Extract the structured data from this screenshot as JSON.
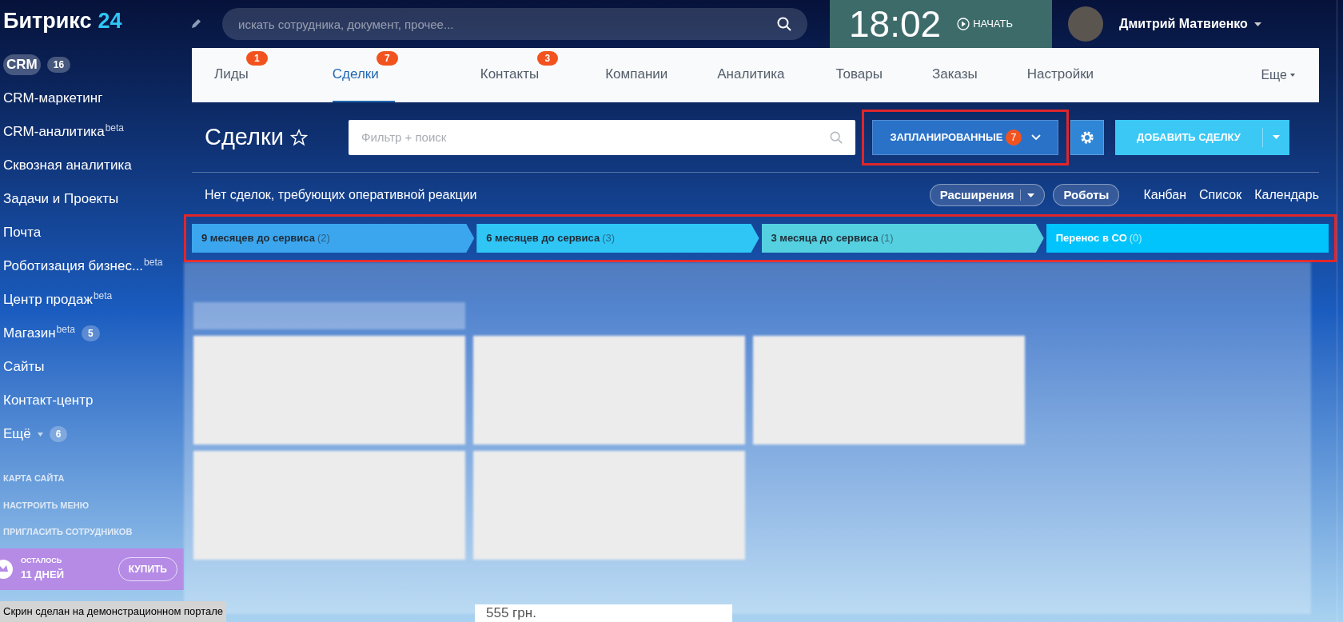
{
  "logo": {
    "name": "Битрикс",
    "number": "24"
  },
  "search": {
    "placeholder": "искать сотрудника, документ, прочее..."
  },
  "clock": {
    "time": "18:02",
    "start_label": "НАЧАТЬ"
  },
  "user": {
    "name": "Дмитрий Матвиенко"
  },
  "sidebar": {
    "items": [
      {
        "label": "CRM",
        "selected": true,
        "counter": "16"
      },
      {
        "label": "CRM-маркетинг",
        "selected": false
      },
      {
        "label": "CRM-аналитика",
        "selected": false,
        "sup": "beta"
      },
      {
        "label": "Сквозная аналитика",
        "selected": false
      },
      {
        "label": "Задачи и Проекты",
        "selected": false
      },
      {
        "label": "Почта",
        "selected": false
      },
      {
        "label": "Роботизация бизнес...",
        "selected": false,
        "sup": "beta"
      },
      {
        "label": "Центр продаж",
        "selected": false,
        "sup": "beta"
      },
      {
        "label": "Магазин",
        "selected": false,
        "sup": "beta",
        "counter": "5"
      },
      {
        "label": "Сайты",
        "selected": false
      },
      {
        "label": "Контакт-центр",
        "selected": false
      },
      {
        "label": "Ещё",
        "selected": false,
        "caret": true,
        "counter": "6"
      }
    ],
    "links": [
      "КАРТА САЙТА",
      "НАСТРОИТЬ МЕНЮ",
      "ПРИГЛАСИТЬ СОТРУДНИКОВ"
    ],
    "promo": {
      "caption": "ОСТАЛОСЬ",
      "days": "11 ДНЕЙ",
      "button": "КУПИТЬ"
    }
  },
  "tabs": [
    {
      "label": "Лиды",
      "counter": "1",
      "selected": false
    },
    {
      "label": "Сделки",
      "counter": "7",
      "selected": true
    },
    {
      "label": "Контакты",
      "counter": "3",
      "selected": false
    },
    {
      "label": "Компании",
      "selected": false
    },
    {
      "label": "Аналитика",
      "selected": false
    },
    {
      "label": "Товары",
      "selected": false
    },
    {
      "label": "Заказы",
      "selected": false
    },
    {
      "label": "Настройки",
      "selected": false
    }
  ],
  "more_tab": "Еще",
  "page_title": "Сделки",
  "filter": {
    "placeholder": "Фильтр + поиск"
  },
  "planned_button": {
    "label": "ЗАПЛАНИРОВАННЫЕ",
    "counter": "7",
    "highlighted": true
  },
  "add_button": {
    "label": "ДОБАВИТЬ СДЕЛКУ"
  },
  "notice": "Нет сделок, требующих оперативной реакции",
  "toolbar": {
    "extensions": "Расширения",
    "robots": "Роботы",
    "views": [
      "Канбан",
      "Список",
      "Календарь"
    ]
  },
  "stages": {
    "highlighted": true,
    "items": [
      {
        "label": "9 месяцев до сервиса",
        "count": "(2)",
        "color": "#3ba6ee"
      },
      {
        "label": "6 месяцев до сервиса",
        "count": "(3)",
        "color": "#2fc6f6"
      },
      {
        "label": "3 месяца до сервиса",
        "count": "(1)",
        "color": "#55d0e0"
      },
      {
        "label": "Перенос в СО",
        "count": "(0)",
        "color": "#00c4fb"
      }
    ]
  },
  "board": {
    "visible_amount": "555 грн."
  },
  "caption": "Скрин сделан на демонстрационном портале"
}
